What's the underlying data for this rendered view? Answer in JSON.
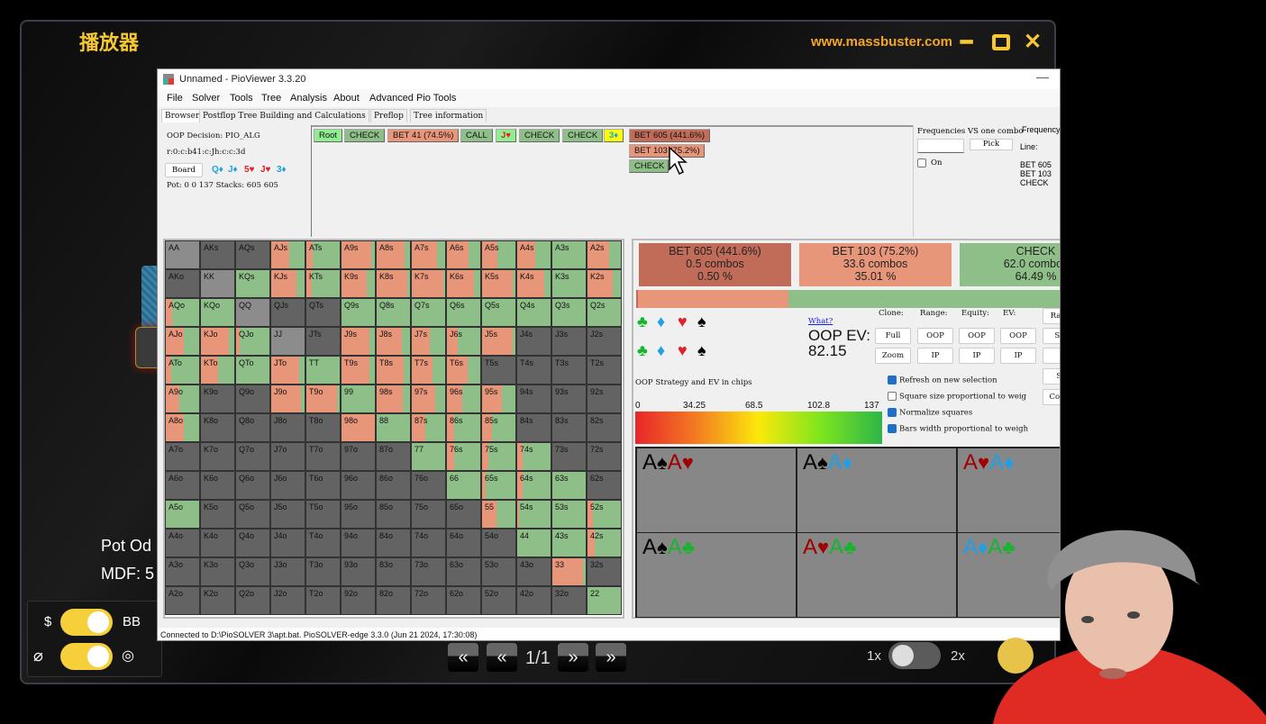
{
  "player": {
    "title": "播放器",
    "site": "www.massbuster.com",
    "window_controls": [
      "minimize-icon",
      "maximize-icon",
      "close-icon"
    ],
    "pot_odds_label": "Pot Od",
    "mdf_label": "MDF: 5",
    "toggle_currency": {
      "left": "$",
      "right": "BB",
      "on": true
    },
    "toggle_visibility": {
      "left_icon": "eye-off-icon",
      "right_icon": "eye-icon",
      "on": true
    },
    "nav": {
      "first": "⏮",
      "prev": "⏪",
      "page": "1/1",
      "next": "⏩",
      "last": "⏭"
    },
    "speed": {
      "left": "1x",
      "right": "2x",
      "on": false
    }
  },
  "pio": {
    "title": "Unnamed  - PioViewer 3.3.20",
    "menu": [
      "File",
      "Solver",
      "Tools",
      "Tree",
      "Analysis",
      "About",
      "Advanced Pio Tools"
    ],
    "tabs": [
      "Browser",
      "Postflop Tree Building and Calculations",
      "Preflop",
      "Tree information"
    ],
    "active_tab": 0,
    "decision": "OOP Decision:  PIO_ALG",
    "line_code": "r:0:c:b41:c:Jh:c:c:3d",
    "board_button": "Board",
    "board_cards": [
      {
        "text": "Q♦",
        "color": "#1ea0e6"
      },
      {
        "text": "J♦",
        "color": "#1ea0e6"
      },
      {
        "text": "5♥",
        "color": "#e0202a"
      },
      {
        "text": "J♥",
        "color": "#e0202a"
      },
      {
        "text": "3♦",
        "color": "#1ea0e6"
      }
    ],
    "pot_stacks": "Pot: 0 0 137 Stacks: 605 605",
    "line_buttons": [
      {
        "label": "Root",
        "type": "root"
      },
      {
        "label": "CHECK",
        "type": "check"
      },
      {
        "label": "BET 41 (74.5%)",
        "type": "bet"
      },
      {
        "label": "CALL",
        "type": "check"
      },
      {
        "label": "J♥",
        "type": "card-heart"
      },
      {
        "label": "CHECK",
        "type": "check"
      },
      {
        "label": "CHECK",
        "type": "check"
      },
      {
        "label": "3♦",
        "type": "card-diamond"
      }
    ],
    "options": [
      {
        "label": "BET 605 (441.6%)",
        "type": "bigbet"
      },
      {
        "label": "BET 103 (75.2%)",
        "type": "bet"
      },
      {
        "label": "CHECK",
        "type": "check"
      }
    ],
    "freq_panel": {
      "title": "Frequencies VS one combo",
      "title2": "Frequency a",
      "input_value": "",
      "pick": "Pick",
      "line_label": "Line:",
      "on_label": "On",
      "on_checked": false,
      "line_items": [
        "BET 605",
        "BET 103",
        "CHECK"
      ]
    },
    "colors": {
      "bet": "#e8967a",
      "bigbet": "#c06c58",
      "check": "#8fbf88",
      "root": "#90ee90",
      "out": "#636363",
      "pair_gray": "#8c8c8c"
    },
    "ranks": [
      "A",
      "K",
      "Q",
      "J",
      "T",
      "9",
      "8",
      "7",
      "6",
      "5",
      "4",
      "3",
      "2"
    ],
    "grid_note": "each value = fraction of bet (rest check); x = not in range; g = gray (no combos / blocked)",
    "grid": [
      [
        "g",
        "x",
        "x",
        0.55,
        0.18,
        0.9,
        0.85,
        0.75,
        0.65,
        0.45,
        0.55,
        0,
        0.65
      ],
      [
        "x",
        "g",
        0,
        0.75,
        0.15,
        0.75,
        0.92,
        0.95,
        0.82,
        0.92,
        0.8,
        0,
        0.75
      ],
      [
        0.2,
        0,
        "g",
        "x",
        "x",
        0,
        0,
        0,
        0,
        0,
        0,
        0,
        0
      ],
      [
        0.55,
        0.85,
        0.12,
        "g",
        "x",
        0.85,
        0.75,
        0.55,
        0.32,
        0.92,
        "x",
        "x",
        "x"
      ],
      [
        0.15,
        0.5,
        0,
        0.85,
        0,
        0.85,
        0.8,
        0.62,
        0.62,
        "x",
        "x",
        "x",
        "x"
      ],
      [
        0.4,
        "x",
        "x",
        0.9,
        0.92,
        0,
        0.78,
        0.7,
        0.45,
        0.6,
        "x",
        "x",
        "x"
      ],
      [
        0.55,
        "x",
        "x",
        "x",
        "x",
        1.0,
        0,
        0.4,
        0.22,
        0.3,
        "x",
        "x",
        "x"
      ],
      [
        "x",
        "x",
        "x",
        "x",
        "x",
        "x",
        "x",
        0,
        0.22,
        0.2,
        0.15,
        "x",
        "x"
      ],
      [
        "x",
        "x",
        "x",
        "x",
        "x",
        "x",
        "x",
        "x",
        0,
        0.1,
        0.15,
        0,
        "x"
      ],
      [
        0,
        "x",
        "x",
        "x",
        "x",
        "x",
        "x",
        "x",
        "x",
        0.42,
        0.05,
        0,
        0.15
      ],
      [
        "x",
        "x",
        "x",
        "x",
        "x",
        "x",
        "x",
        "x",
        "x",
        "x",
        0,
        0,
        0.22
      ],
      [
        "x",
        "x",
        "x",
        "x",
        "x",
        "x",
        "x",
        "x",
        "x",
        "x",
        "x",
        0.92,
        "x"
      ],
      [
        "x",
        "x",
        "x",
        "x",
        "x",
        "x",
        "x",
        "x",
        "x",
        "x",
        "x",
        "x",
        0
      ]
    ],
    "summary": [
      {
        "action": "BET 605 (441.6%)",
        "combos": "0.5 combos",
        "pct": "0.50 %",
        "type": "bigbet",
        "freq": 0.005
      },
      {
        "action": "BET 103 (75.2%)",
        "combos": "33.6 combos",
        "pct": "35.01 %",
        "type": "bet",
        "freq": 0.3501
      },
      {
        "action": "CHECK",
        "combos": "62.0 combos",
        "pct": "64.49 %",
        "type": "check",
        "freq": 0.6449
      }
    ],
    "what_link": "What?",
    "ev_label": "OOP EV:",
    "ev_value": "82.15",
    "headers": [
      "Clone:",
      "Range:",
      "Equity:",
      "EV:"
    ],
    "buttons": {
      "full": "Full",
      "zoom": "Zoom",
      "range_oop": "OOP",
      "range_ip": "IP",
      "eq_oop": "OOP",
      "eq_ip": "IP",
      "ev_oop": "OOP",
      "ev_ip": "IP",
      "side": [
        "Rang",
        "Str",
        "S",
        "St",
        "Comp"
      ]
    },
    "checkboxes": [
      {
        "label": "Refresh on new selection",
        "checked": true
      },
      {
        "label": "Square size proportional to weig",
        "checked": false
      },
      {
        "label": "Normalize squares",
        "checked": true
      },
      {
        "label": "Bars width proportional to weigh",
        "checked": true
      }
    ],
    "strategy_label": "OOP Strategy and EV in chips",
    "scale": [
      "0",
      "34.25",
      "68.5",
      "102.8",
      "137"
    ],
    "combos": [
      [
        {
          "r": "A",
          "s": "♠",
          "c": "#000"
        },
        {
          "r": "A",
          "s": "♥",
          "c": "#a00000"
        }
      ],
      [
        {
          "r": "A",
          "s": "♠",
          "c": "#000"
        },
        {
          "r": "A",
          "s": "♦",
          "c": "#1ea0e6"
        }
      ],
      [
        {
          "r": "A",
          "s": "♥",
          "c": "#a00000"
        },
        {
          "r": "A",
          "s": "♦",
          "c": "#1ea0e6"
        }
      ],
      [
        {
          "r": "A",
          "s": "♠",
          "c": "#000"
        },
        {
          "r": "A",
          "s": "♣",
          "c": "#17b52e"
        }
      ],
      [
        {
          "r": "A",
          "s": "♥",
          "c": "#a00000"
        },
        {
          "r": "A",
          "s": "♣",
          "c": "#17b52e"
        }
      ],
      [
        {
          "r": "A",
          "s": "♦",
          "c": "#1ea0e6"
        },
        {
          "r": "A",
          "s": "♣",
          "c": "#17b52e"
        }
      ]
    ],
    "status": "Connected to D:\\PioSOLVER 3\\apt.bat. PioSOLVER-edge 3.3.0 (Jun 21 2024, 17:30:08)"
  }
}
